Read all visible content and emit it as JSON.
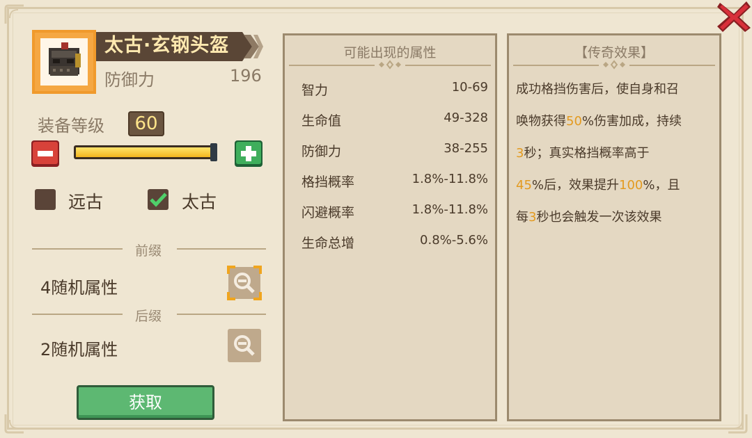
{
  "item": {
    "name": "太古·玄钢头盔",
    "stat_label": "防御力",
    "stat_value": "196",
    "icon": "helmet-icon"
  },
  "level": {
    "label": "装备等级",
    "value": "60",
    "fraction": 1.0
  },
  "grades": [
    {
      "label": "远古",
      "checked": false
    },
    {
      "label": "太古",
      "checked": true
    }
  ],
  "prefix": {
    "title": "前缀",
    "text": "4随机属性"
  },
  "suffix": {
    "title": "后缀",
    "text": "2随机属性"
  },
  "get_button": "获取",
  "attributes_panel": {
    "title": "可能出现的属性",
    "rows": [
      {
        "name": "智力",
        "range": "10-69"
      },
      {
        "name": "生命值",
        "range": "49-328"
      },
      {
        "name": "防御力",
        "range": "38-255"
      },
      {
        "name": "格挡概率",
        "range": "1.8%-11.8%"
      },
      {
        "name": "闪避概率",
        "range": "1.8%-11.8%"
      },
      {
        "name": "生命总增",
        "range": "0.8%-5.6%"
      }
    ]
  },
  "legend_panel": {
    "title": "【传奇效果】",
    "lines": [
      [
        {
          "t": "成功格挡伤害后，使自身和召",
          "hl": false
        }
      ],
      [
        {
          "t": "唤物获得",
          "hl": false
        },
        {
          "t": "50",
          "hl": true
        },
        {
          "t": "%伤害加成，持续",
          "hl": false
        }
      ],
      [
        {
          "t": "3",
          "hl": true
        },
        {
          "t": "秒；真实格挡概率高于",
          "hl": false
        }
      ],
      [
        {
          "t": "45",
          "hl": true
        },
        {
          "t": "%后，效果提升",
          "hl": false
        },
        {
          "t": "100",
          "hl": true
        },
        {
          "t": "%，且",
          "hl": false
        }
      ],
      [
        {
          "t": "每",
          "hl": false
        },
        {
          "t": "3",
          "hl": true
        },
        {
          "t": "秒也会触发一次该效果",
          "hl": false
        }
      ]
    ]
  },
  "colors": {
    "background": "#efe6d2",
    "panel": "#e4d8c2",
    "highlight": "#e39a1f",
    "button_green": "#5db872",
    "minus_red": "#d8423a",
    "plus_green": "#3fae5c",
    "close_red": "#d8303a"
  }
}
